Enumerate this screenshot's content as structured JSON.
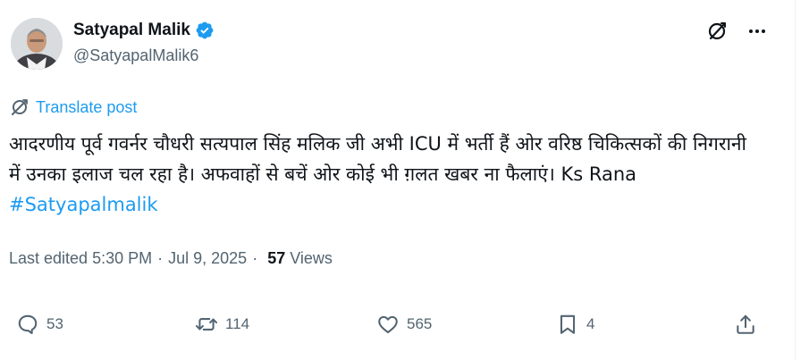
{
  "author": {
    "name": "Satyapal Malik",
    "handle": "@SatyapalMalik6",
    "verified": true,
    "verified_color": "#1d9bf0"
  },
  "top_actions": {
    "grok_icon": "grok-icon",
    "more_icon": "more-icon"
  },
  "translate": {
    "label": "Translate post",
    "icon": "translate-icon",
    "color": "#1d9bf0"
  },
  "post": {
    "text": "आदरणीय पूर्व गवर्नर चौधरी सत्यपाल सिंह मलिक जी अभी ICU में भर्ती हैं ओर वरिष्ठ चिकित्सकों की निगरानी में उनका इलाज चल रहा है। अफवाहों से बचें ओर कोई भी ग़लत खबर ना फैलाएं। Ks Rana  ",
    "hashtag": "#Satyapalmalik"
  },
  "meta": {
    "edited": "Last edited 5:30 PM",
    "date": "Jul 9, 2025",
    "separator": "·",
    "views_count": "57",
    "views_label": "Views"
  },
  "actions": {
    "replies": "53",
    "reposts": "114",
    "likes": "565",
    "bookmarks": "4"
  }
}
